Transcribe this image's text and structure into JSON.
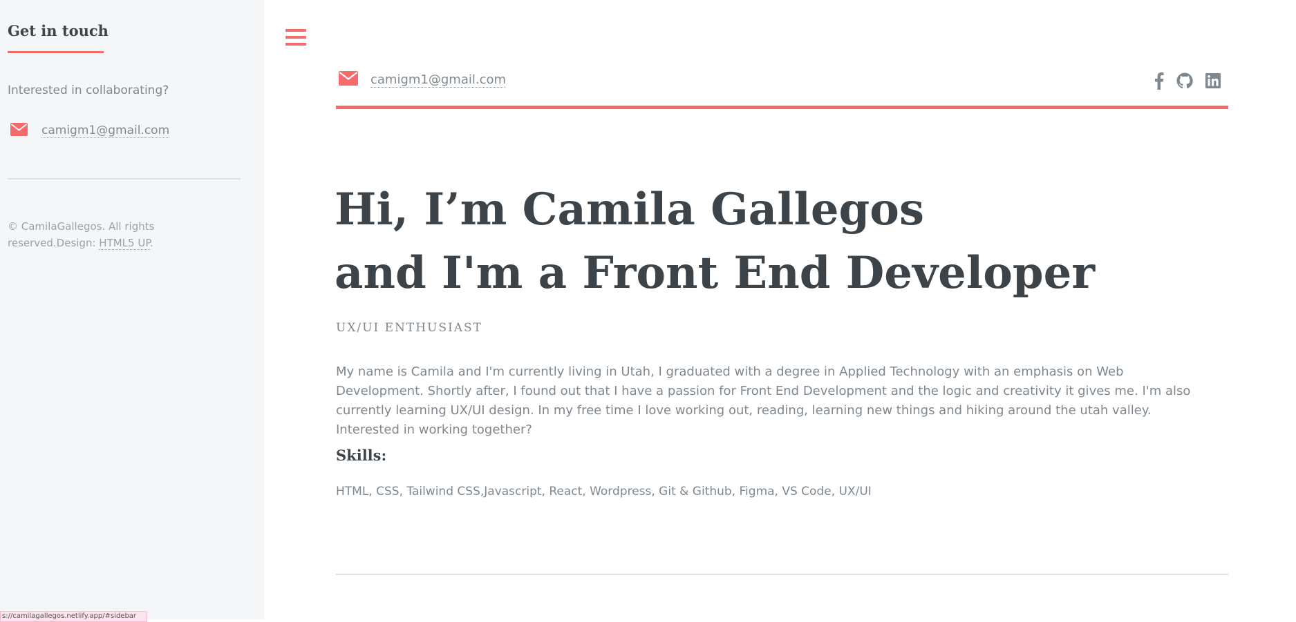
{
  "colors": {
    "accent": "#f56a6a",
    "heading": "#3d4449",
    "text": "#7f888f",
    "sidebar_bg": "#f5f6f7"
  },
  "sidebar": {
    "heading": "Get in touch",
    "intro": "Interested in collaborating?",
    "email": "camigm1@gmail.com",
    "email_icon": "envelope-icon",
    "copyright_text": "© CamilaGallegos. All rights reserved.Design: ",
    "copyright_link": "HTML5 UP",
    "copyright_end": "."
  },
  "status_bar": {
    "url": "s://camilagallegos.netlify.app/#sidebar"
  },
  "header": {
    "menu_icon": "hamburger-menu-icon",
    "email": "camigm1@gmail.com",
    "email_icon": "envelope-icon",
    "socials": [
      {
        "name": "facebook",
        "icon": "facebook-icon"
      },
      {
        "name": "github",
        "icon": "github-icon"
      },
      {
        "name": "linkedin",
        "icon": "linkedin-icon"
      }
    ]
  },
  "hero": {
    "title_line1": "Hi, I’m Camila Gallegos",
    "title_line2": "and I'm a Front End Developer",
    "subtitle": "UX/UI Enthusiast",
    "bio": "My name is Camila and I'm currently living in Utah, I graduated with a degree in Applied Technology with an emphasis on Web Development. Shortly after, I found out that I have a passion for Front End Development and the logic and creativity it gives me. I'm also currently learning UX/UI design. In my free time I love working out, reading, learning new things and hiking around the utah valley. Interested in working together?",
    "skills_heading": "Skills:",
    "skills": "HTML, CSS, Tailwind CSS,Javascript, React, Wordpress, Git & Github, Figma, VS Code, UX/UI"
  }
}
